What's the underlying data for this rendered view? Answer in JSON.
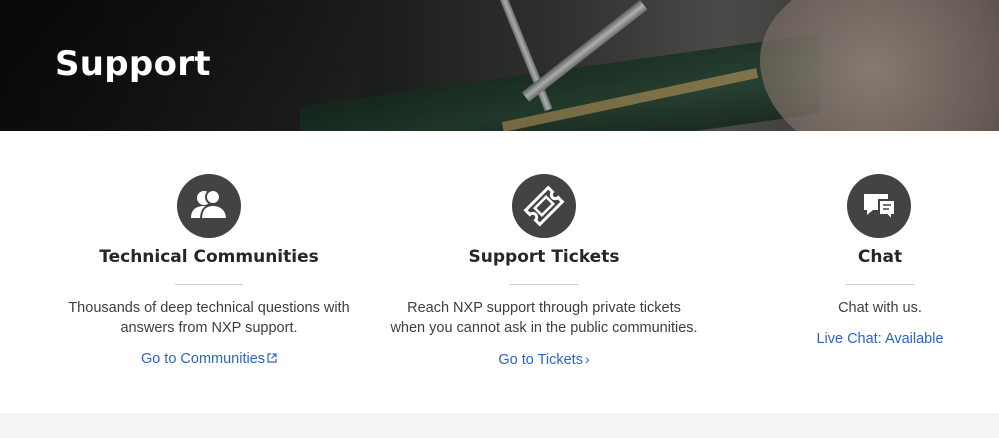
{
  "hero": {
    "title": "Support"
  },
  "cards": [
    {
      "title": "Technical Communities",
      "description_line1": "Thousands of deep technical questions with",
      "description_line2": "answers from NXP support.",
      "link_label": "Go to Communities",
      "link_icon": "external-link-icon",
      "icon": "users-icon"
    },
    {
      "title": "Support Tickets",
      "description_line1": "Reach NXP support through private tickets",
      "description_line2": "when you cannot ask in the public communities.",
      "link_label": "Go to Tickets",
      "link_icon": "chevron-right-icon",
      "link_chevron": "›",
      "icon": "ticket-icon"
    },
    {
      "title": "Chat",
      "description_line1": "Chat with us.",
      "link_label": "Live Chat: Available",
      "icon": "chat-bubbles-icon"
    }
  ],
  "colors": {
    "link": "#2b66c4",
    "icon_circle": "#434343",
    "heading": "#262626",
    "footer_band": "#f4f4f5"
  }
}
